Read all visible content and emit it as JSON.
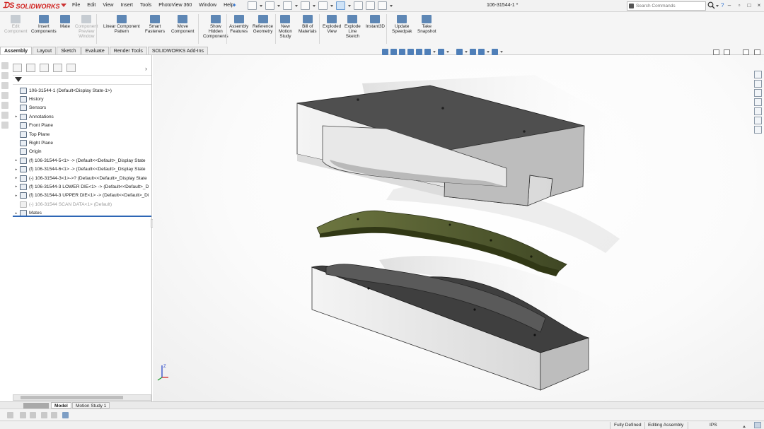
{
  "app": {
    "brand": "SOLIDWORKS",
    "document_title": "106-31544-1 *"
  },
  "menu": [
    "File",
    "Edit",
    "View",
    "Insert",
    "Tools",
    "PhotoView 360",
    "Window",
    "Help"
  ],
  "search": {
    "placeholder": "Search Commands"
  },
  "commands": [
    {
      "label": "Edit\nComponent",
      "enabled": false
    },
    {
      "label": "Insert\nComponents",
      "enabled": true
    },
    {
      "label": "Mate",
      "enabled": true
    },
    {
      "label": "Component\nPreview\nWindow",
      "enabled": false
    },
    {
      "label": "Linear Component\nPattern",
      "enabled": true
    },
    {
      "label": "Smart\nFasteners",
      "enabled": true
    },
    {
      "label": "Move\nComponent",
      "enabled": true
    },
    {
      "label": "Show\nHidden\nComponents",
      "enabled": true
    },
    {
      "label": "Assembly\nFeatures",
      "enabled": true
    },
    {
      "label": "Reference\nGeometry",
      "enabled": true
    },
    {
      "label": "New\nMotion\nStudy",
      "enabled": true
    },
    {
      "label": "Bill of\nMaterials",
      "enabled": true
    },
    {
      "label": "Exploded\nView",
      "enabled": true
    },
    {
      "label": "Explode\nLine\nSketch",
      "enabled": true
    },
    {
      "label": "Instant3D",
      "enabled": true
    },
    {
      "label": "Update\nSpeedpak",
      "enabled": true
    },
    {
      "label": "Take\nSnapshot",
      "enabled": true
    }
  ],
  "tabs": [
    "Assembly",
    "Layout",
    "Sketch",
    "Evaluate",
    "Render Tools",
    "SOLIDWORKS Add-Ins"
  ],
  "tree": {
    "root": "106-31544-1  (Default<Display State-1>)",
    "items": [
      {
        "label": "History",
        "expand": false,
        "dim": false
      },
      {
        "label": "Sensors",
        "expand": false,
        "dim": false
      },
      {
        "label": "Annotations",
        "expand": true,
        "dim": false
      },
      {
        "label": "Front Plane",
        "expand": false,
        "dim": false
      },
      {
        "label": "Top Plane",
        "expand": false,
        "dim": false
      },
      {
        "label": "Right Plane",
        "expand": false,
        "dim": false
      },
      {
        "label": "Origin",
        "expand": false,
        "dim": false
      },
      {
        "label": "(f) 106-31544-5<1> -> (Default<<Default>_Display State",
        "expand": true,
        "dim": false
      },
      {
        "label": "(f) 106-31544-6<1> -> (Default<<Default>_Display State",
        "expand": true,
        "dim": false
      },
      {
        "label": "(-) 106-31544-3<1>->? (Default<<Default>_Display State",
        "expand": true,
        "dim": false
      },
      {
        "label": "(f) 106-31544-3 LOWER DIE<1> -> (Default<<Default>_D",
        "expand": true,
        "dim": false
      },
      {
        "label": "(f) 106-31544-3 UPPER DIE<1> -> (Default<<Default>_Di",
        "expand": true,
        "dim": false
      },
      {
        "label": "(-) 106-31544 SCAN DATA<1> (Default)",
        "expand": false,
        "dim": true
      },
      {
        "label": "Mates",
        "expand": true,
        "dim": false
      }
    ]
  },
  "bottom_tabs": [
    "Model",
    "Motion Study 1"
  ],
  "status": {
    "state": "Fully Defined",
    "mode": "Editing Assembly",
    "units": "IPS"
  },
  "icons": {
    "pin": "pin-icon",
    "filter": "filter-icon",
    "search": "search-icon",
    "help": "help-icon",
    "triad": "axis-triad-icon"
  },
  "colors": {
    "brand": "#d0201d",
    "accent": "#2d66b5",
    "part_green": "#55602e",
    "die_face": "#4b4b4b"
  }
}
